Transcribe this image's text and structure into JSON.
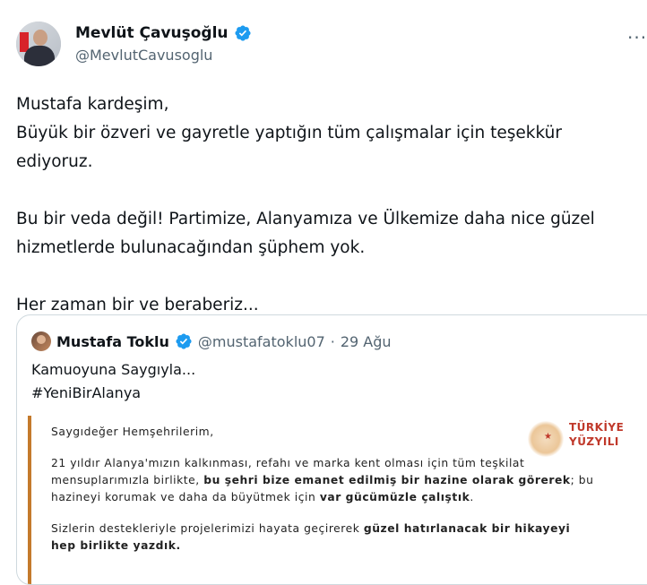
{
  "author": {
    "name": "Mevlüt Çavuşoğlu",
    "handle": "@MevlutCavusoglu"
  },
  "more_icon": "more-horizontal-icon",
  "tweet": {
    "paragraphs": [
      "Mustafa kardeşim,",
      "Büyük bir özveri ve gayretle yaptığın tüm çalışmalar için teşekkür ediyoruz.",
      "Bu bir veda değil! Partimize, Alanyamıza ve Ülkemize daha nice güzel hizmetlerde bulunacağından şüphem yok.",
      "Her zaman bir ve beraberiz..."
    ]
  },
  "quoted": {
    "name": "Mustafa Toklu",
    "handle": "@mustafatoklu07",
    "separator": "·",
    "date": "29 Ağu",
    "text_line1": "Kamuoyuna Saygıyla...",
    "text_line2": "#YeniBirAlanya",
    "letter": {
      "salutation": "Saygıdeğer Hemşehrilerim,",
      "p1_line1": "21 yıldır Alanya'mızın kalkınması, refahı ve marka kent olması için tüm teşkilat",
      "p1_line2_a": "mensuplarımızla birlikte, ",
      "p1_line2_b": "bu şehri bize emanet edilmiş bir hazine olarak görerek",
      "p1_line2_c": "; bu",
      "p1_line3_a": "hazineyi korumak ve daha da büyütmek için ",
      "p1_line3_b": "var gücümüzle çalıştık",
      "p1_line3_c": ".",
      "p2_line1_a": "Sizlerin destekleriyle projelerimizi hayata geçirerek ",
      "p2_line1_b": "güzel hatırlanacak bir hikayeyi",
      "p2_line2": "hep birlikte yazdık."
    },
    "logo": {
      "line1": "TÜRKİYE",
      "line2": "YÜZYILI"
    }
  },
  "colors": {
    "verified": "#1d9bf0",
    "text": "#0f1419",
    "secondary": "#536471",
    "border": "#cfd9de",
    "letter_accent": "#c47a2c",
    "logo_red": "#c0392b"
  }
}
